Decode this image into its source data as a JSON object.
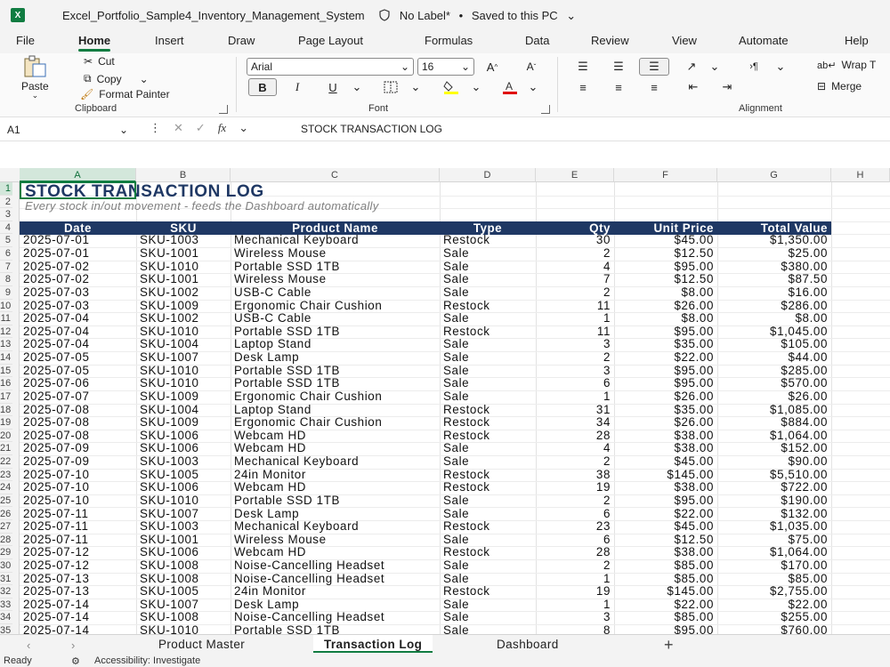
{
  "window": {
    "file_name": "Excel_Portfolio_Sample4_Inventory_Management_System",
    "label_status": "No Label*",
    "save_status": "Saved to this PC"
  },
  "menu": [
    "File",
    "Home",
    "Insert",
    "Draw",
    "Page Layout",
    "Formulas",
    "Data",
    "Review",
    "View",
    "Automate",
    "Help"
  ],
  "ribbon": {
    "paste": "Paste",
    "cut": "Cut",
    "copy": "Copy",
    "format_painter": "Format Painter",
    "clipboard_label": "Clipboard",
    "font_name": "Arial",
    "font_size": "16",
    "bold": "B",
    "italic": "I",
    "underline": "U",
    "font_label": "Font",
    "wrap_text": "Wrap T",
    "merge": "Merge",
    "alignment_label": "Alignment"
  },
  "formula_bar": {
    "name_box": "A1",
    "fx": "fx",
    "content": "STOCK TRANSACTION LOG"
  },
  "columns": [
    "A",
    "B",
    "C",
    "D",
    "E",
    "F",
    "G",
    "H"
  ],
  "sheet": {
    "title": "STOCK TRANSACTION LOG",
    "subtitle": "Every stock in/out movement - feeds the Dashboard automatically",
    "headers": [
      "Date",
      "SKU",
      "Product Name",
      "Type",
      "Qty",
      "Unit Price",
      "Total Value"
    ],
    "rows": [
      [
        "2025-07-01",
        "SKU-1003",
        "Mechanical Keyboard",
        "Restock",
        "30",
        "$45.00",
        "$1,350.00"
      ],
      [
        "2025-07-01",
        "SKU-1001",
        "Wireless Mouse",
        "Sale",
        "2",
        "$12.50",
        "$25.00"
      ],
      [
        "2025-07-02",
        "SKU-1010",
        "Portable SSD 1TB",
        "Sale",
        "4",
        "$95.00",
        "$380.00"
      ],
      [
        "2025-07-02",
        "SKU-1001",
        "Wireless Mouse",
        "Sale",
        "7",
        "$12.50",
        "$87.50"
      ],
      [
        "2025-07-03",
        "SKU-1002",
        "USB-C Cable",
        "Sale",
        "2",
        "$8.00",
        "$16.00"
      ],
      [
        "2025-07-03",
        "SKU-1009",
        "Ergonomic Chair Cushion",
        "Restock",
        "11",
        "$26.00",
        "$286.00"
      ],
      [
        "2025-07-04",
        "SKU-1002",
        "USB-C Cable",
        "Sale",
        "1",
        "$8.00",
        "$8.00"
      ],
      [
        "2025-07-04",
        "SKU-1010",
        "Portable SSD 1TB",
        "Restock",
        "11",
        "$95.00",
        "$1,045.00"
      ],
      [
        "2025-07-04",
        "SKU-1004",
        "Laptop Stand",
        "Sale",
        "3",
        "$35.00",
        "$105.00"
      ],
      [
        "2025-07-05",
        "SKU-1007",
        "Desk Lamp",
        "Sale",
        "2",
        "$22.00",
        "$44.00"
      ],
      [
        "2025-07-05",
        "SKU-1010",
        "Portable SSD 1TB",
        "Sale",
        "3",
        "$95.00",
        "$285.00"
      ],
      [
        "2025-07-06",
        "SKU-1010",
        "Portable SSD 1TB",
        "Sale",
        "6",
        "$95.00",
        "$570.00"
      ],
      [
        "2025-07-07",
        "SKU-1009",
        "Ergonomic Chair Cushion",
        "Sale",
        "1",
        "$26.00",
        "$26.00"
      ],
      [
        "2025-07-08",
        "SKU-1004",
        "Laptop Stand",
        "Restock",
        "31",
        "$35.00",
        "$1,085.00"
      ],
      [
        "2025-07-08",
        "SKU-1009",
        "Ergonomic Chair Cushion",
        "Restock",
        "34",
        "$26.00",
        "$884.00"
      ],
      [
        "2025-07-08",
        "SKU-1006",
        "Webcam HD",
        "Restock",
        "28",
        "$38.00",
        "$1,064.00"
      ],
      [
        "2025-07-09",
        "SKU-1006",
        "Webcam HD",
        "Sale",
        "4",
        "$38.00",
        "$152.00"
      ],
      [
        "2025-07-09",
        "SKU-1003",
        "Mechanical Keyboard",
        "Sale",
        "2",
        "$45.00",
        "$90.00"
      ],
      [
        "2025-07-10",
        "SKU-1005",
        "24in Monitor",
        "Restock",
        "38",
        "$145.00",
        "$5,510.00"
      ],
      [
        "2025-07-10",
        "SKU-1006",
        "Webcam HD",
        "Restock",
        "19",
        "$38.00",
        "$722.00"
      ],
      [
        "2025-07-10",
        "SKU-1010",
        "Portable SSD 1TB",
        "Sale",
        "2",
        "$95.00",
        "$190.00"
      ],
      [
        "2025-07-11",
        "SKU-1007",
        "Desk Lamp",
        "Sale",
        "6",
        "$22.00",
        "$132.00"
      ],
      [
        "2025-07-11",
        "SKU-1003",
        "Mechanical Keyboard",
        "Restock",
        "23",
        "$45.00",
        "$1,035.00"
      ],
      [
        "2025-07-11",
        "SKU-1001",
        "Wireless Mouse",
        "Sale",
        "6",
        "$12.50",
        "$75.00"
      ],
      [
        "2025-07-12",
        "SKU-1006",
        "Webcam HD",
        "Restock",
        "28",
        "$38.00",
        "$1,064.00"
      ],
      [
        "2025-07-12",
        "SKU-1008",
        "Noise-Cancelling Headset",
        "Sale",
        "2",
        "$85.00",
        "$170.00"
      ],
      [
        "2025-07-13",
        "SKU-1008",
        "Noise-Cancelling Headset",
        "Sale",
        "1",
        "$85.00",
        "$85.00"
      ],
      [
        "2025-07-13",
        "SKU-1005",
        "24in Monitor",
        "Restock",
        "19",
        "$145.00",
        "$2,755.00"
      ],
      [
        "2025-07-14",
        "SKU-1007",
        "Desk Lamp",
        "Sale",
        "1",
        "$22.00",
        "$22.00"
      ],
      [
        "2025-07-14",
        "SKU-1008",
        "Noise-Cancelling Headset",
        "Sale",
        "3",
        "$85.00",
        "$255.00"
      ],
      [
        "2025-07-14",
        "SKU-1010",
        "Portable SSD 1TB",
        "Sale",
        "8",
        "$95.00",
        "$760.00"
      ]
    ]
  },
  "sheet_tabs": [
    "Product Master",
    "Transaction Log",
    "Dashboard"
  ],
  "active_sheet": "Transaction Log",
  "status": {
    "ready": "Ready",
    "accessibility": "Accessibility: Investigate"
  },
  "colors": {
    "header_fill": "#1f3864",
    "title_color": "#1f3864",
    "excel_green": "#107c41"
  }
}
